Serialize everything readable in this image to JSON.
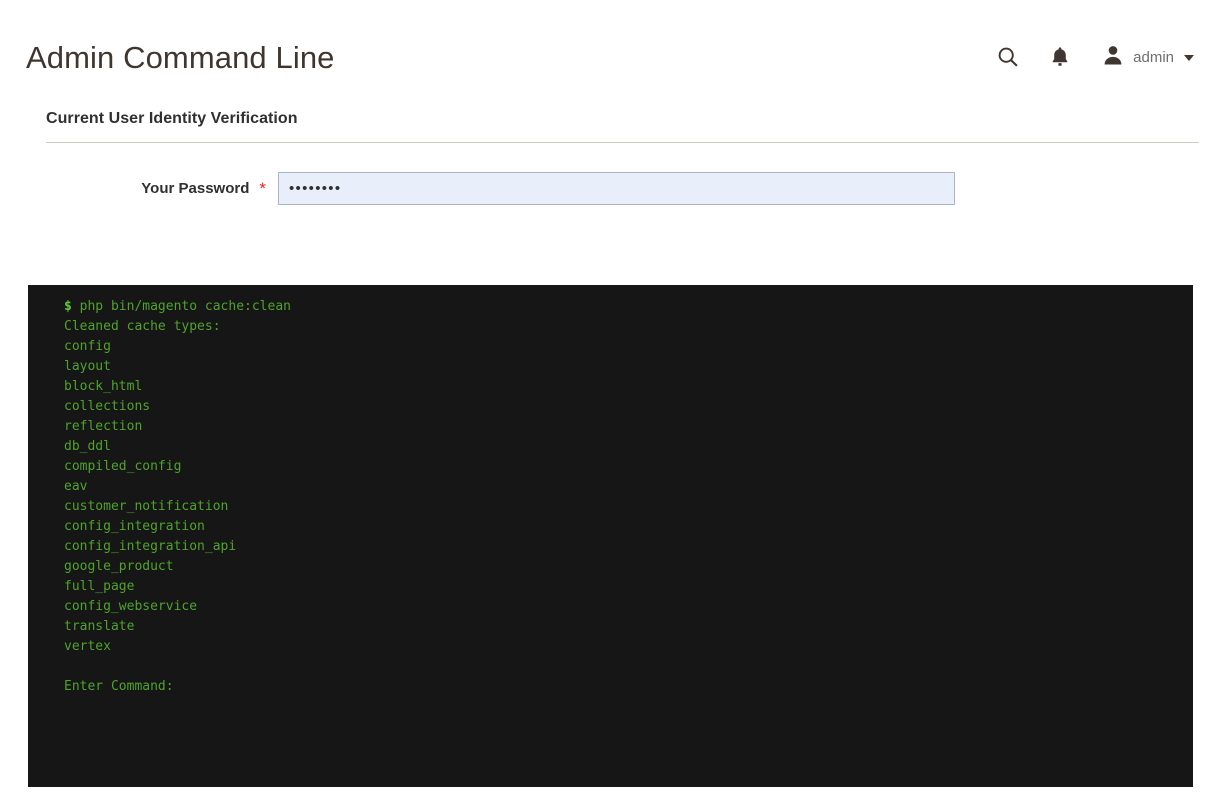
{
  "header": {
    "title": "Admin Command Line",
    "search_icon": "search-icon",
    "notifications_icon": "bell-icon",
    "avatar_icon": "user-avatar-icon",
    "user_name": "admin",
    "chevron_icon": "chevron-down-icon"
  },
  "section": {
    "title": "Current User Identity Verification",
    "field": {
      "label": "Your Password",
      "required_mark": "*",
      "value": "••••••••",
      "placeholder": ""
    }
  },
  "terminal": {
    "prompt_symbol": "$",
    "command": " php bin/magento cache:clean",
    "lines": [
      "Cleaned cache types:",
      "config",
      "layout",
      "block_html",
      "collections",
      "reflection",
      "db_ddl",
      "compiled_config",
      "eav",
      "customer_notification",
      "config_integration",
      "config_integration_api",
      "google_product",
      "full_page",
      "config_webservice",
      "translate",
      "vertex",
      "",
      "Enter Command:"
    ]
  },
  "colors": {
    "terminal_bg": "#161616",
    "terminal_text": "#4fa32c",
    "terminal_prompt": "#62c93b",
    "required": "#e22626",
    "input_bg": "#e9eefb",
    "input_border": "#adb2c4",
    "divider": "#d1cbc2",
    "title": "#41362f"
  }
}
